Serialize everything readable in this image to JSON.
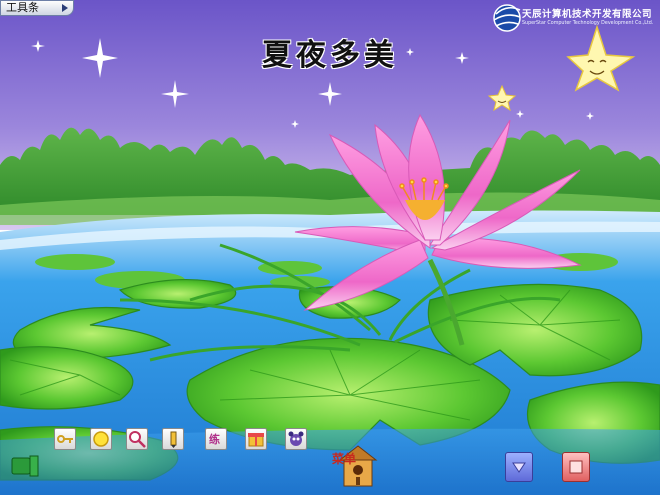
{
  "toolbar": {
    "label": "工具条"
  },
  "page": {
    "title": "夏夜多美"
  },
  "company": {
    "name": "天辰计算机技术开发有限公司",
    "english_name": "SuperStar Computer Technology Development Co.,Ltd."
  },
  "bottom_bar": {
    "menu_label": "菜单",
    "practice_label": "练"
  },
  "colors": {
    "sky_top": "#6b55c8",
    "sky_bottom": "#d8c8f0",
    "water": "#2b8fe0",
    "lotus": "#f07ad0",
    "leaf": "#3fb52a"
  }
}
